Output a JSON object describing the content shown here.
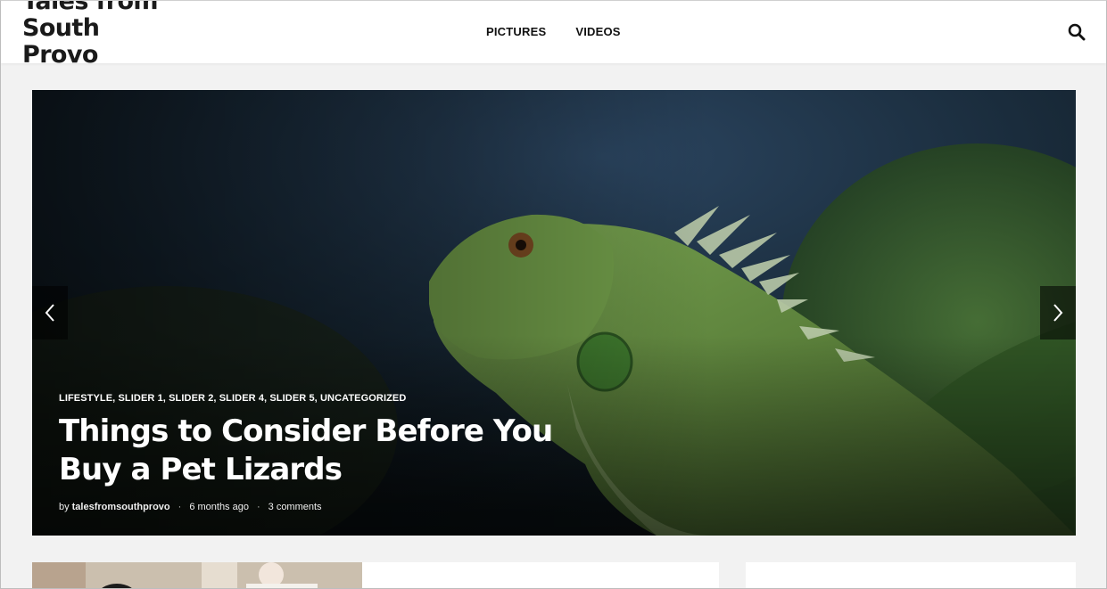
{
  "site": {
    "logo_lines": [
      "Tales from",
      "South",
      "Provo"
    ]
  },
  "nav": {
    "items": [
      {
        "label": "PICTURES"
      },
      {
        "label": "VIDEOS"
      }
    ]
  },
  "icons": {
    "search": "search-icon",
    "prev": "chevron-left-icon",
    "next": "chevron-right-icon"
  },
  "slider": {
    "categories": "LIFESTYLE, SLIDER 1, SLIDER 2, SLIDER 4, SLIDER 5, UNCATEGORIZED",
    "title": "Things to Consider Before You Buy a Pet Lizards",
    "by_label": "by",
    "author": "talesfromsouthprovo",
    "time_ago": "6 months ago",
    "comments": "3 comments",
    "separator": "·"
  },
  "colors": {
    "header_bg": "#ffffff",
    "page_bg": "#f2f2f2",
    "text_dark": "#111111",
    "iguana_green": "#5f8a3c"
  }
}
